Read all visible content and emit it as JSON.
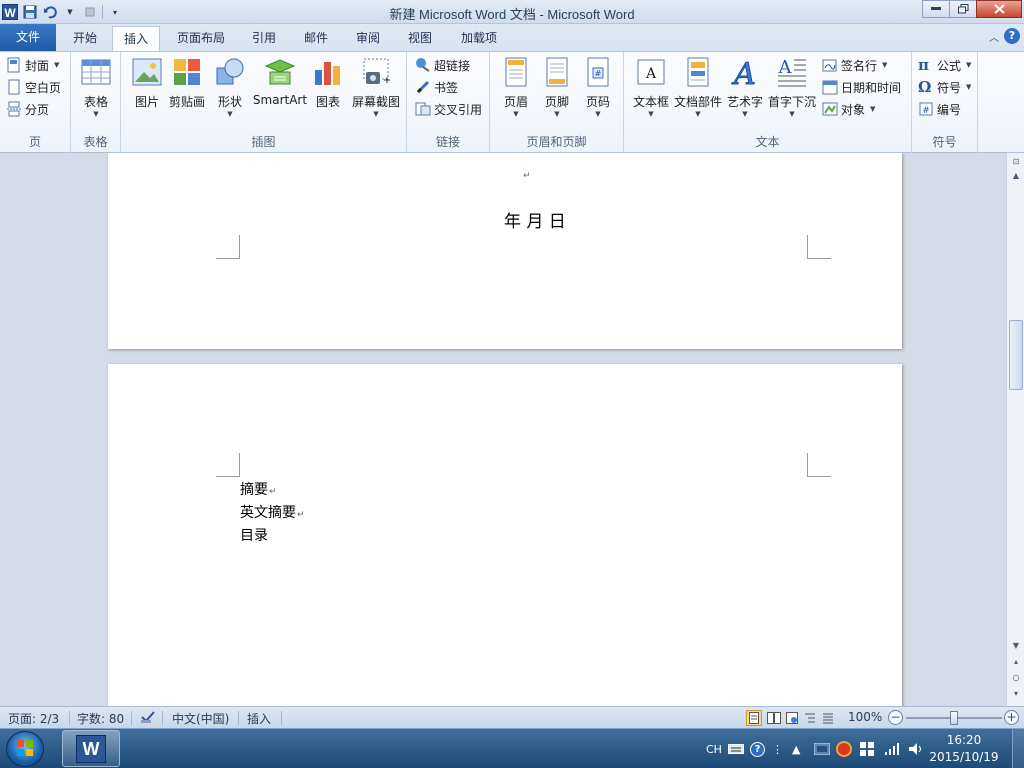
{
  "window": {
    "title": "新建 Microsoft Word 文档  -  Microsoft Word",
    "app_icon": "W"
  },
  "menu": {
    "file": "文件",
    "tabs": [
      "开始",
      "插入",
      "页面布局",
      "引用",
      "邮件",
      "审阅",
      "视图",
      "加载项"
    ],
    "active_tab": "插入"
  },
  "ribbon": {
    "pages": {
      "label": "页",
      "items": [
        "封面",
        "空白页",
        "分页"
      ]
    },
    "tables": {
      "label": "表格",
      "table": "表格"
    },
    "illustrations": {
      "label": "插图",
      "items": [
        "图片",
        "剪贴画",
        "形状",
        "SmartArt",
        "图表",
        "屏幕截图"
      ]
    },
    "links": {
      "label": "链接",
      "items": [
        "超链接",
        "书签",
        "交叉引用"
      ]
    },
    "header_footer": {
      "label": "页眉和页脚",
      "items": [
        "页眉",
        "页脚",
        "页码"
      ]
    },
    "text": {
      "label": "文本",
      "items": [
        "文本框",
        "文档部件",
        "艺术字",
        "首字下沉"
      ],
      "side": [
        "签名行",
        "日期和时间",
        "对象"
      ]
    },
    "symbols": {
      "label": "符号",
      "items": [
        "公式",
        "符号",
        "编号"
      ]
    }
  },
  "document": {
    "page1_date": "年    月    日",
    "page2_lines": [
      "摘要",
      "英文摘要",
      "目录"
    ]
  },
  "statusbar": {
    "page": "页面: 2/3",
    "words": "字数: 80",
    "language": "中文(中国)",
    "mode": "插入",
    "zoom": "100%"
  },
  "taskbar": {
    "ime": "CH",
    "time": "16:20",
    "date": "2015/10/19",
    "word_icon": "W"
  },
  "colors": {
    "file_tab": "#2b5aa3",
    "accent": "#2b5797",
    "taskbar": "#1d4a78"
  }
}
